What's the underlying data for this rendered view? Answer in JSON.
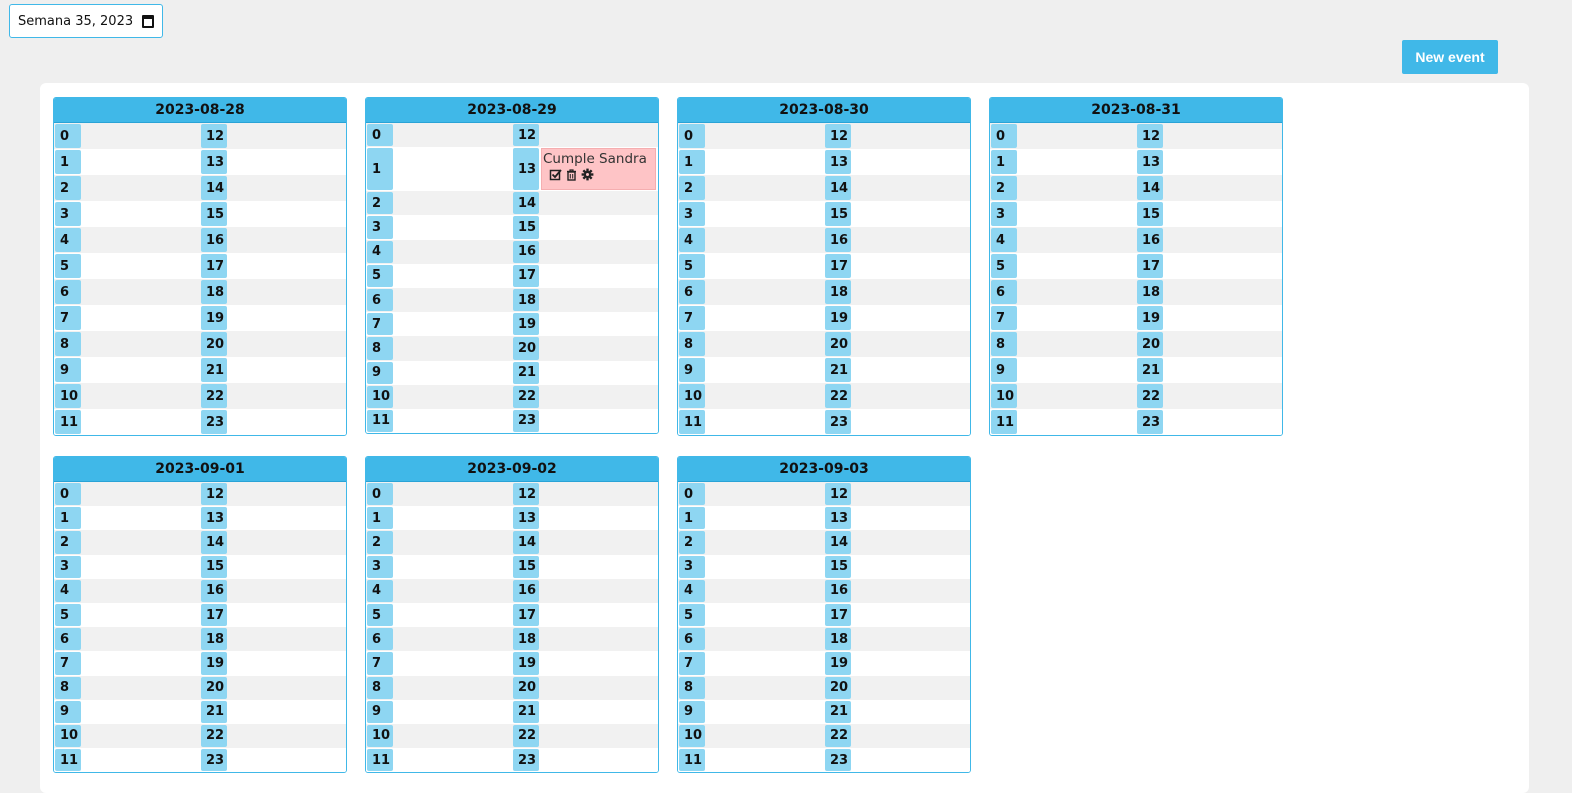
{
  "week_selector": {
    "value": "Semana 35, 2023"
  },
  "new_event_button": {
    "label": "New event"
  },
  "days": [
    {
      "date": "2023-08-28",
      "events": []
    },
    {
      "date": "2023-08-29",
      "events": [
        {
          "hour": 13,
          "title": "Cumple Sandra",
          "actions": [
            "check-square-icon",
            "trash-icon",
            "gear-icon"
          ]
        }
      ]
    },
    {
      "date": "2023-08-30",
      "events": []
    },
    {
      "date": "2023-08-31",
      "events": []
    },
    {
      "date": "2023-09-01",
      "events": []
    },
    {
      "date": "2023-09-02",
      "events": []
    },
    {
      "date": "2023-09-03",
      "events": []
    }
  ],
  "hours_left": [
    "0",
    "1",
    "2",
    "3",
    "4",
    "5",
    "6",
    "7",
    "8",
    "9",
    "10",
    "11"
  ],
  "hours_right": [
    "12",
    "13",
    "14",
    "15",
    "16",
    "17",
    "18",
    "19",
    "20",
    "21",
    "22",
    "23"
  ],
  "colors": {
    "accent": "#40b8e8",
    "hour_badge": "#8ed6f2",
    "event_bg": "#fec4c6"
  }
}
